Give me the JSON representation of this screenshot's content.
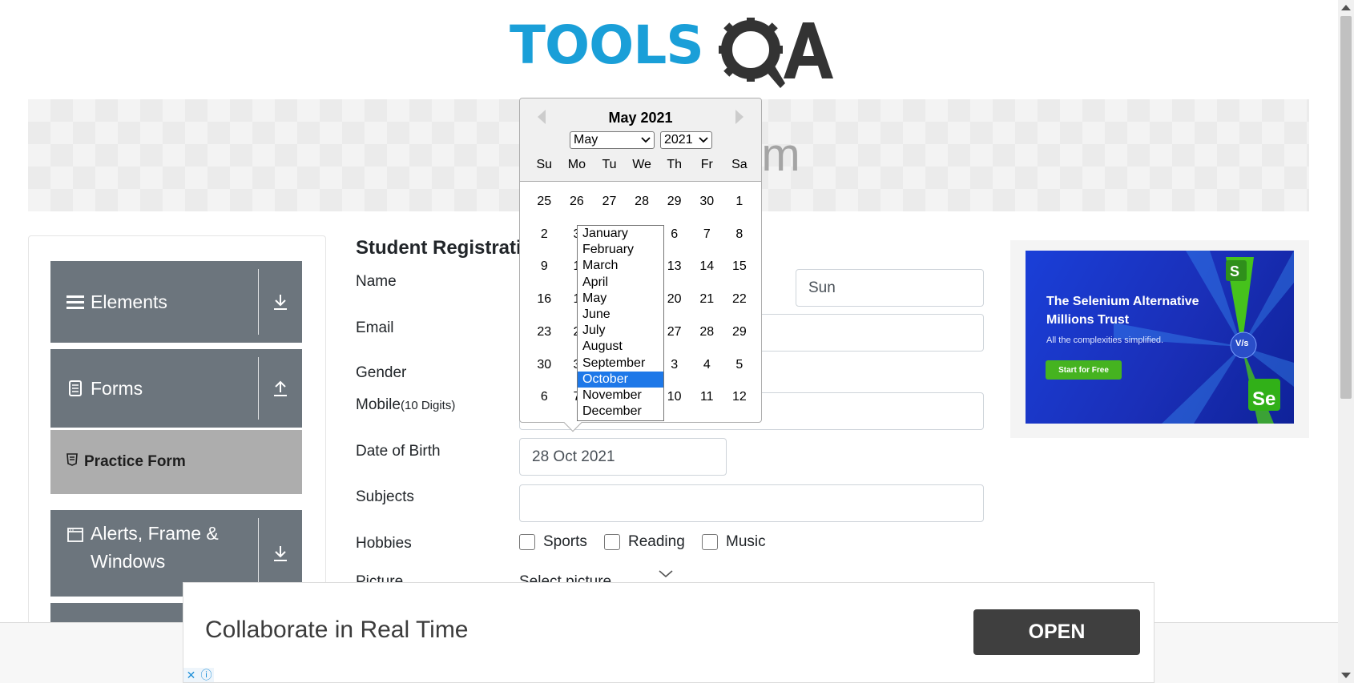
{
  "logo": {
    "text": "TOOLS",
    "suffix": "QA"
  },
  "banner": {
    "title": "rm"
  },
  "sidebar": {
    "groups": [
      {
        "label": "Elements",
        "icon": "hamburger-icon",
        "arrow": "download-icon"
      },
      {
        "label": "Forms",
        "icon": "document-icon",
        "arrow": "upload-icon"
      },
      {
        "label": "Alerts, Frame & Windows",
        "icon": "window-icon",
        "arrow": "download-icon"
      }
    ],
    "active_item": "Practice Form"
  },
  "form": {
    "title": "Student Registratio",
    "name_label": "Name",
    "last_name_value": "Sun",
    "email_label": "Email",
    "gender_label": "Gender",
    "mobile_label": "Mobile",
    "mobile_hint": "(10 Digits)",
    "dob_label": "Date of Birth",
    "dob_value": "28 Oct 2021",
    "subjects_label": "Subjects",
    "hobbies_label": "Hobbies",
    "hobbies": [
      "Sports",
      "Reading",
      "Music"
    ],
    "picture_label": "Picture",
    "picture_value": "Select picture"
  },
  "datepicker": {
    "current_month": "May 2021",
    "month_select": "May",
    "year_select": "2021",
    "weekdays": [
      "Su",
      "Mo",
      "Tu",
      "We",
      "Th",
      "Fr",
      "Sa"
    ],
    "weeks": [
      [
        "25",
        "26",
        "27",
        "28",
        "29",
        "30",
        "1"
      ],
      [
        "2",
        "3",
        "",
        "",
        "6",
        "7",
        "8"
      ],
      [
        "9",
        "1",
        "",
        "",
        "13",
        "14",
        "15"
      ],
      [
        "16",
        "1",
        "",
        "",
        "20",
        "21",
        "22"
      ],
      [
        "23",
        "2",
        "",
        "",
        "27",
        "28",
        "29"
      ],
      [
        "30",
        "3",
        "",
        "",
        "3",
        "4",
        "5"
      ],
      [
        "6",
        "7",
        "",
        "",
        "10",
        "11",
        "12"
      ]
    ],
    "months": [
      "January",
      "February",
      "March",
      "April",
      "May",
      "June",
      "July",
      "August",
      "September",
      "October",
      "November",
      "December"
    ],
    "highlighted_month": "October"
  },
  "right_ad": {
    "headline_1": "The Selenium Alternative",
    "headline_2": "Millions Trust",
    "sub": "All the complexities simplified.",
    "button": "Start for Free",
    "badge_top": "S",
    "badge_bottom": "Se",
    "center_badge": "V/s"
  },
  "bottom_ad": {
    "text": "Collaborate in Real Time",
    "button": "OPEN",
    "close": "✕",
    "info": "ⓘ"
  },
  "colors": {
    "logo_blue": "#1a9fd8",
    "logo_dark": "#333333",
    "sidebar": "#6c757d",
    "selected_month": "#1e78e8",
    "ad_blue": "#1a3fd8",
    "ad_green": "#45b320"
  }
}
